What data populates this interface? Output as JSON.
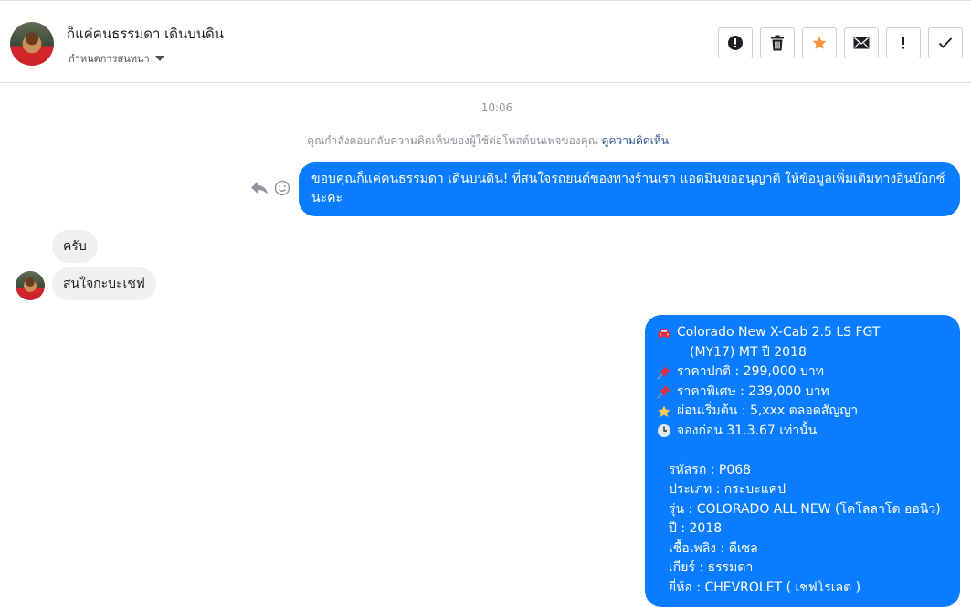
{
  "header": {
    "contact_name": "ก็แค่คนธรรมดา เดินบนดิน",
    "thread_settings_label": "กำหนดการสนทนา"
  },
  "toolbar": {
    "icons": [
      "report-icon",
      "trash-icon",
      "star-icon",
      "envelope-icon",
      "exclamation-icon",
      "check-icon"
    ],
    "star_color": "#f7923b"
  },
  "conversation": {
    "timestamp": "10:06",
    "reply_notice": "คุณกำลังตอบกลับความคิดเห็นของผู้ใช้ต่อโพสต์บนเพจของคุณ",
    "reply_notice_link": "ดูความคิดเห็น",
    "messages": [
      {
        "from": "page",
        "text": "ขอบคุณก็แค่คนธรรมดา เดินบนดิน! ที่สนใจรถยนต์ของทางร้านเรา แอดมินขออนุญาติ ให้ข้อมูลเพิ่มเติมทางอินบ๊อกซ์นะคะ"
      },
      {
        "from": "user",
        "text": "ครับ"
      },
      {
        "from": "user",
        "text": "สนใจกะบะเชฟ"
      }
    ],
    "listing": {
      "title_line1": "Colorado New X-Cab 2.5 LS FGT",
      "title_line2": "(MY17) MT ปี 2018",
      "normal_price": "ราคาปกติ : 299,000 บาท",
      "special_price": "ราคาพิเศษ : 239,000 บาท",
      "installment": "ผ่อนเริ่มต้น : 5,xxx ตลอดสัญญา",
      "booking": "จองก่อน 31.3.67 เท่านั้น",
      "code": "รหัสรถ : P068",
      "type": "ประเภท : กระบะแคป",
      "model": "รุ่น : COLORADO ALL NEW (โคโลลาโด ออนิว)",
      "year": "ปี : 2018",
      "fuel": "เชื้อเพลิง : ดีเซล",
      "gear": "เกียร์ : ธรรมดา",
      "brand": "ยี่ห้อ : CHEVROLET ( เชฟโรเลต )"
    }
  },
  "colors": {
    "outgoing_bubble": "#0a7cff",
    "incoming_bubble": "#f1f0f0",
    "link": "#365899"
  }
}
